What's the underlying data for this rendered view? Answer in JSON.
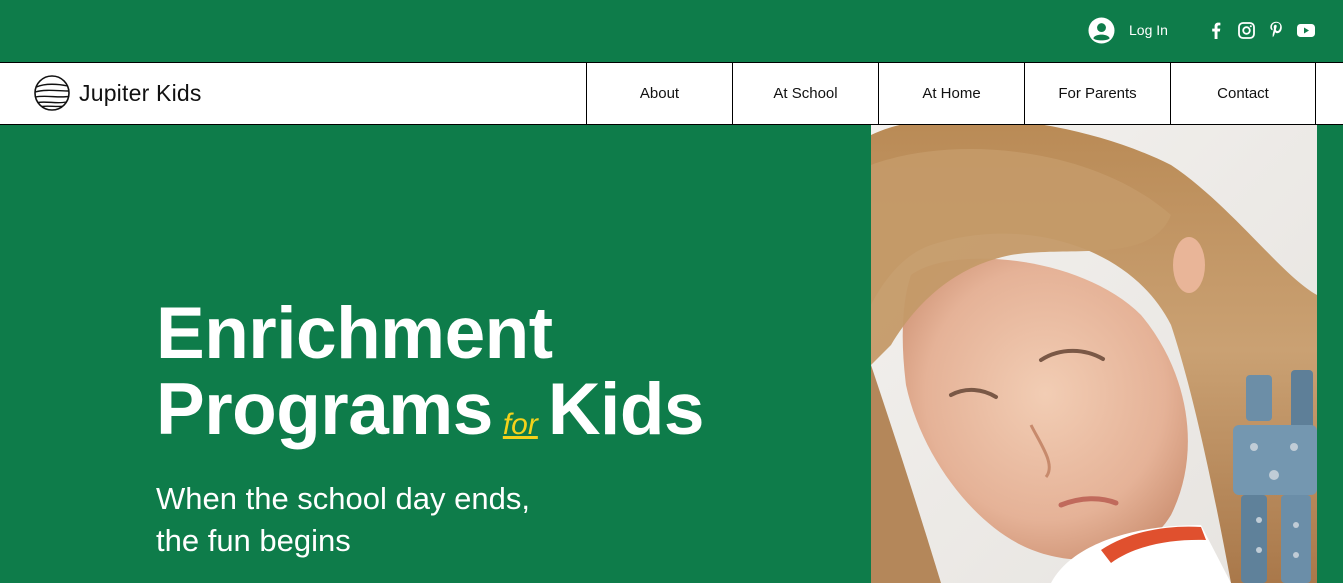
{
  "header": {
    "login_label": "Log In",
    "social": [
      {
        "icon": "facebook-icon"
      },
      {
        "icon": "instagram-icon"
      },
      {
        "icon": "pinterest-icon"
      },
      {
        "icon": "youtube-icon"
      }
    ]
  },
  "brand": {
    "name": "Jupiter Kids",
    "logo_icon": "planet-logo-icon"
  },
  "nav": {
    "items": [
      "About",
      "At School",
      "At Home",
      "For Parents",
      "Contact"
    ]
  },
  "hero": {
    "title_line1": "Enrichment",
    "title_line2_a": "Programs",
    "title_for": "for",
    "title_line2_b": "Kids",
    "subtitle_line1": "When the school day ends,",
    "subtitle_line2": "the fun begins",
    "image_icon": "girl-with-robot-photo"
  },
  "colors": {
    "background": "#0e7c4a",
    "accent": "#f4d21b",
    "nav_bg": "#ffffff"
  }
}
